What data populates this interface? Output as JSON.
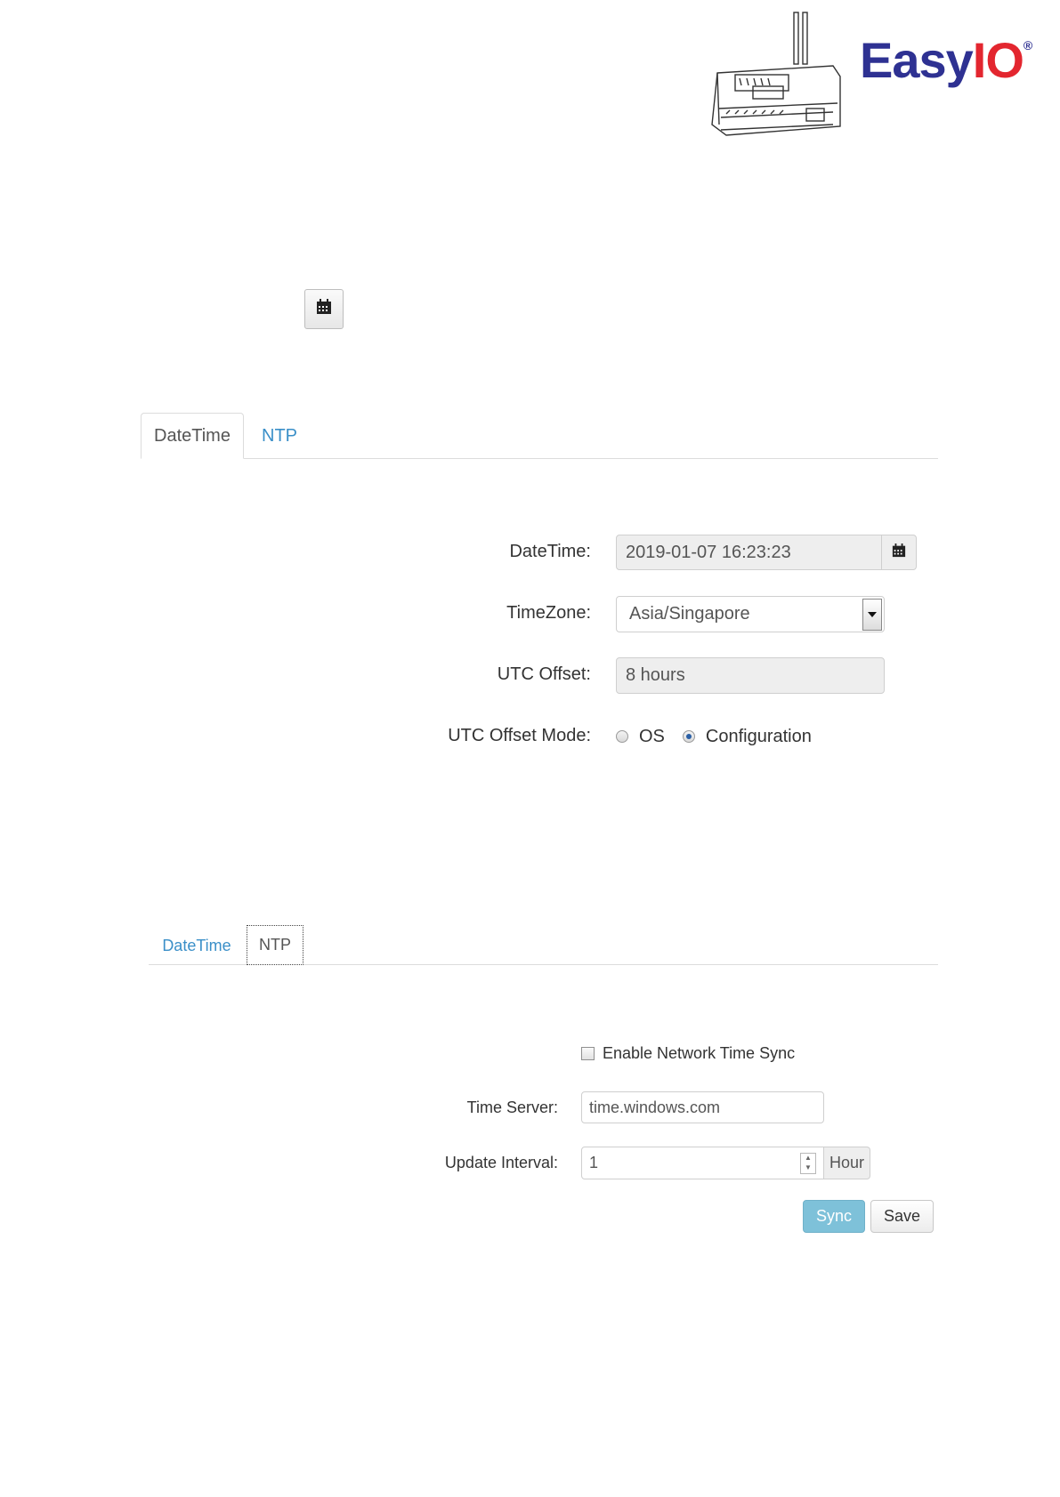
{
  "header": {
    "brand_easy": "Easy",
    "brand_io": "IO",
    "brand_reg": "®"
  },
  "datetime_panel": {
    "tabs": [
      {
        "label": "DateTime"
      },
      {
        "label": "NTP"
      }
    ],
    "datetime_label": "DateTime:",
    "datetime_value": "2019-01-07 16:23:23",
    "timezone_label": "TimeZone:",
    "timezone_value": "Asia/Singapore",
    "utc_offset_label": "UTC Offset:",
    "utc_offset_value": "8 hours",
    "utc_offset_mode_label": "UTC Offset Mode:",
    "mode_options": [
      {
        "label": "OS",
        "checked": false
      },
      {
        "label": "Configuration",
        "checked": true
      }
    ]
  },
  "ntp_panel": {
    "tabs": [
      {
        "label": "DateTime"
      },
      {
        "label": "NTP"
      }
    ],
    "enable_label": "Enable Network Time Sync",
    "enable_checked": false,
    "time_server_label": "Time Server:",
    "time_server_value": "time.windows.com",
    "update_interval_label": "Update Interval:",
    "update_interval_value": "1",
    "update_interval_unit": "Hour",
    "sync_label": "Sync",
    "save_label": "Save"
  },
  "colors": {
    "link": "#3a8fc8",
    "sync_button": "#7ec1d9",
    "brand_blue": "#2e3192",
    "brand_red": "#e3262f"
  },
  "icons": {
    "calendar": "calendar-icon",
    "dropdown": "caret-down-icon",
    "spinner": "spinner-arrows-icon"
  }
}
